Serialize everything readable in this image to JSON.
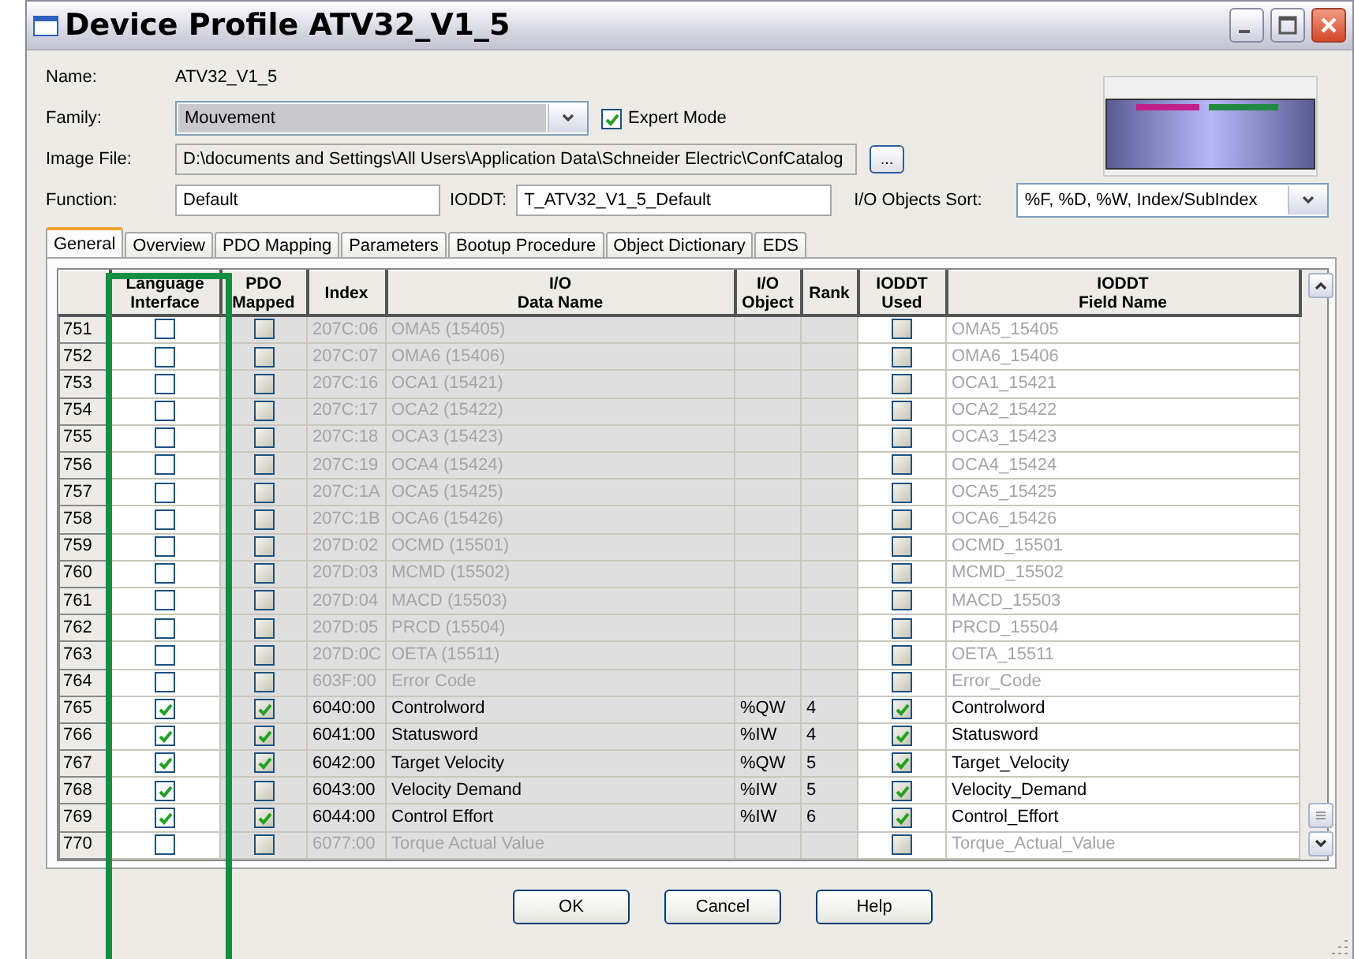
{
  "window": {
    "title": "Device Profile ATV32_V1_5"
  },
  "form": {
    "name_label": "Name:",
    "name_value": "ATV32_V1_5",
    "family_label": "Family:",
    "family_value": "Mouvement",
    "expert_mode": {
      "label": "Expert Mode",
      "checked": true
    },
    "image_file_label": "Image File:",
    "image_file_value": "D:\\documents and Settings\\All Users\\Application Data\\Schneider Electric\\ConfCatalog",
    "browse_button": "...",
    "function_label": "Function:",
    "function_value": "Default",
    "ioddt_label": "IODDT:",
    "ioddt_value": "T_ATV32_V1_5_Default",
    "sort_label": "I/O Objects Sort:",
    "sort_value": "%F, %D, %W, Index/SubIndex"
  },
  "tabs": [
    {
      "label": "General",
      "selected": true
    },
    {
      "label": "Overview",
      "selected": false
    },
    {
      "label": "PDO Mapping",
      "selected": false
    },
    {
      "label": "Parameters",
      "selected": false
    },
    {
      "label": "Bootup Procedure",
      "selected": false
    },
    {
      "label": "Object Dictionary",
      "selected": false
    },
    {
      "label": "EDS",
      "selected": false
    }
  ],
  "table": {
    "columns": [
      {
        "lines": [
          "Language",
          "Interface"
        ]
      },
      {
        "lines": [
          "PDO",
          "Mapped"
        ]
      },
      {
        "lines": [
          "Index"
        ]
      },
      {
        "lines": [
          "I/O",
          "Data Name"
        ]
      },
      {
        "lines": [
          "I/O",
          "Object"
        ]
      },
      {
        "lines": [
          "Rank"
        ]
      },
      {
        "lines": [
          "IODDT",
          "Used"
        ]
      },
      {
        "lines": [
          "IODDT",
          "Field Name"
        ]
      }
    ],
    "rows": [
      {
        "number": "751",
        "language_interface": false,
        "pdo_mapped": false,
        "index": "207C:06",
        "data_name": "OMA5 (15405)",
        "io_object": "",
        "rank": "",
        "ioddt_used": false,
        "field_name": "OMA5_15405",
        "disabled": true
      },
      {
        "number": "752",
        "language_interface": false,
        "pdo_mapped": false,
        "index": "207C:07",
        "data_name": "OMA6 (15406)",
        "io_object": "",
        "rank": "",
        "ioddt_used": false,
        "field_name": "OMA6_15406",
        "disabled": true
      },
      {
        "number": "753",
        "language_interface": false,
        "pdo_mapped": false,
        "index": "207C:16",
        "data_name": "OCA1 (15421)",
        "io_object": "",
        "rank": "",
        "ioddt_used": false,
        "field_name": "OCA1_15421",
        "disabled": true
      },
      {
        "number": "754",
        "language_interface": false,
        "pdo_mapped": false,
        "index": "207C:17",
        "data_name": "OCA2 (15422)",
        "io_object": "",
        "rank": "",
        "ioddt_used": false,
        "field_name": "OCA2_15422",
        "disabled": true
      },
      {
        "number": "755",
        "language_interface": false,
        "pdo_mapped": false,
        "index": "207C:18",
        "data_name": "OCA3 (15423)",
        "io_object": "",
        "rank": "",
        "ioddt_used": false,
        "field_name": "OCA3_15423",
        "disabled": true
      },
      {
        "number": "756",
        "language_interface": false,
        "pdo_mapped": false,
        "index": "207C:19",
        "data_name": "OCA4 (15424)",
        "io_object": "",
        "rank": "",
        "ioddt_used": false,
        "field_name": "OCA4_15424",
        "disabled": true
      },
      {
        "number": "757",
        "language_interface": false,
        "pdo_mapped": false,
        "index": "207C:1A",
        "data_name": "OCA5 (15425)",
        "io_object": "",
        "rank": "",
        "ioddt_used": false,
        "field_name": "OCA5_15425",
        "disabled": true
      },
      {
        "number": "758",
        "language_interface": false,
        "pdo_mapped": false,
        "index": "207C:1B",
        "data_name": "OCA6 (15426)",
        "io_object": "",
        "rank": "",
        "ioddt_used": false,
        "field_name": "OCA6_15426",
        "disabled": true
      },
      {
        "number": "759",
        "language_interface": false,
        "pdo_mapped": false,
        "index": "207D:02",
        "data_name": "OCMD (15501)",
        "io_object": "",
        "rank": "",
        "ioddt_used": false,
        "field_name": "OCMD_15501",
        "disabled": true
      },
      {
        "number": "760",
        "language_interface": false,
        "pdo_mapped": false,
        "index": "207D:03",
        "data_name": "MCMD (15502)",
        "io_object": "",
        "rank": "",
        "ioddt_used": false,
        "field_name": "MCMD_15502",
        "disabled": true
      },
      {
        "number": "761",
        "language_interface": false,
        "pdo_mapped": false,
        "index": "207D:04",
        "data_name": "MACD (15503)",
        "io_object": "",
        "rank": "",
        "ioddt_used": false,
        "field_name": "MACD_15503",
        "disabled": true
      },
      {
        "number": "762",
        "language_interface": false,
        "pdo_mapped": false,
        "index": "207D:05",
        "data_name": "PRCD (15504)",
        "io_object": "",
        "rank": "",
        "ioddt_used": false,
        "field_name": "PRCD_15504",
        "disabled": true
      },
      {
        "number": "763",
        "language_interface": false,
        "pdo_mapped": false,
        "index": "207D:0C",
        "data_name": "OETA (15511)",
        "io_object": "",
        "rank": "",
        "ioddt_used": false,
        "field_name": "OETA_15511",
        "disabled": true
      },
      {
        "number": "764",
        "language_interface": false,
        "pdo_mapped": false,
        "index": "603F:00",
        "data_name": "Error Code",
        "io_object": "",
        "rank": "",
        "ioddt_used": false,
        "field_name": "Error_Code",
        "disabled": true
      },
      {
        "number": "765",
        "language_interface": true,
        "pdo_mapped": true,
        "index": "6040:00",
        "data_name": "Controlword",
        "io_object": "%QW",
        "rank": "4",
        "ioddt_used": true,
        "field_name": "Controlword",
        "disabled": false
      },
      {
        "number": "766",
        "language_interface": true,
        "pdo_mapped": true,
        "index": "6041:00",
        "data_name": "Statusword",
        "io_object": "%IW",
        "rank": "4",
        "ioddt_used": true,
        "field_name": "Statusword",
        "disabled": false
      },
      {
        "number": "767",
        "language_interface": true,
        "pdo_mapped": true,
        "index": "6042:00",
        "data_name": "Target Velocity",
        "io_object": "%QW",
        "rank": "5",
        "ioddt_used": true,
        "field_name": "Target_Velocity",
        "disabled": false
      },
      {
        "number": "768",
        "language_interface": true,
        "pdo_mapped": false,
        "index": "6043:00",
        "data_name": "Velocity Demand",
        "io_object": "%IW",
        "rank": "5",
        "ioddt_used": true,
        "field_name": "Velocity_Demand",
        "disabled": false
      },
      {
        "number": "769",
        "language_interface": true,
        "pdo_mapped": true,
        "index": "6044:00",
        "data_name": "Control Effort",
        "io_object": "%IW",
        "rank": "6",
        "ioddt_used": true,
        "field_name": "Control_Effort",
        "disabled": false
      },
      {
        "number": "770",
        "language_interface": false,
        "pdo_mapped": false,
        "index": "6077:00",
        "data_name": "Torque Actual Value",
        "io_object": "",
        "rank": "",
        "ioddt_used": false,
        "field_name": "Torque_Actual_Value",
        "disabled": true
      }
    ]
  },
  "buttons": [
    {
      "label": "OK"
    },
    {
      "label": "Cancel"
    },
    {
      "label": "Help"
    }
  ]
}
